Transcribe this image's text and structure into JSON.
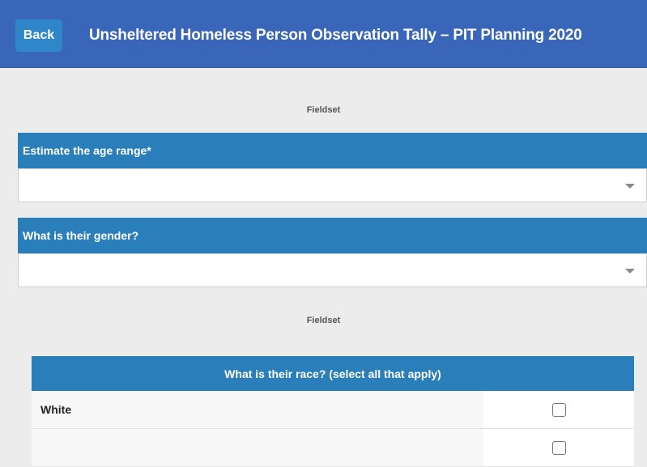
{
  "header": {
    "back_label": "Back",
    "title": "Unsheltered Homeless Person Observation Tally – PIT Planning 2020",
    "background_color": "#3966b8"
  },
  "fieldsets": {
    "first_label": "Fieldset",
    "second_label": "Fieldset"
  },
  "questions": {
    "age": {
      "label": "Estimate the age range*",
      "value": ""
    },
    "gender": {
      "label": "What is their gender?",
      "value": ""
    }
  },
  "race": {
    "header": "What is their race? (select all that apply)",
    "options": [
      {
        "label": "White",
        "checked": false
      },
      {
        "label": "",
        "checked": false
      }
    ]
  },
  "colors": {
    "question_header": "#2a7fba",
    "back_button": "#2f86c8"
  },
  "icons": {
    "select_caret": "caret-down-icon",
    "checkbox": "checkbox-icon"
  }
}
